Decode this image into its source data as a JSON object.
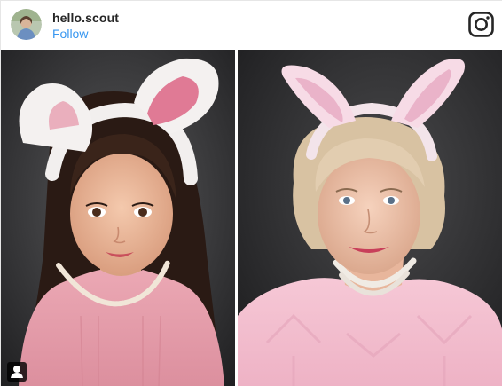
{
  "post": {
    "username": "hello.scout",
    "follow_label": "Follow"
  },
  "icons": {
    "avatar": "profile-photo",
    "brand": "instagram-icon",
    "tag": "user-tag-icon"
  },
  "colors": {
    "follow_link": "#3897f0",
    "username": "#262626",
    "left_sweater": "#e8a0ad",
    "right_sweater": "#f2bfd0"
  }
}
